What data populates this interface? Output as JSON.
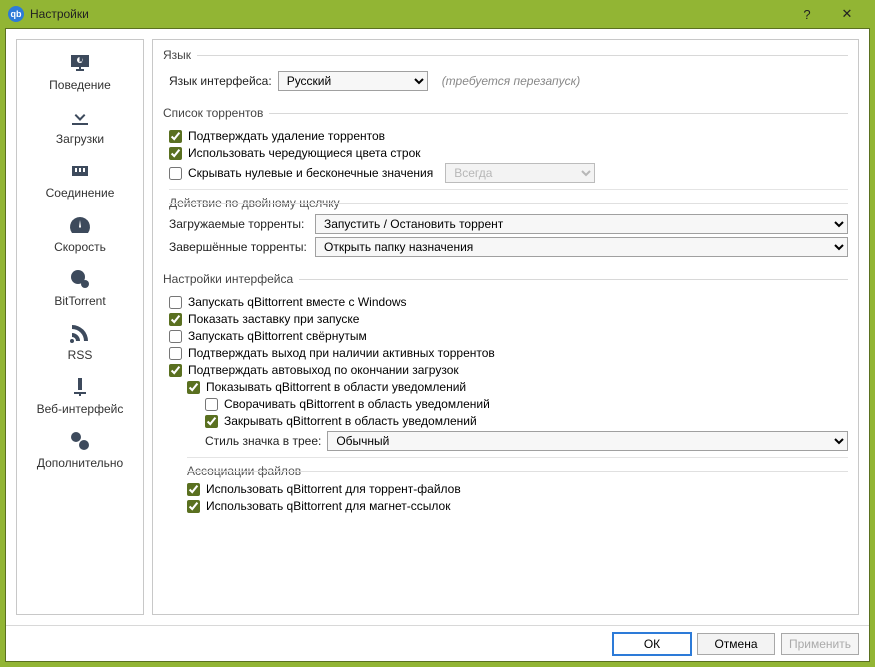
{
  "window": {
    "title": "Настройки",
    "app_icon_text": "qb"
  },
  "sidebar": {
    "items": [
      {
        "label": "Поведение"
      },
      {
        "label": "Загрузки"
      },
      {
        "label": "Соединение"
      },
      {
        "label": "Скорость"
      },
      {
        "label": "BitTorrent"
      },
      {
        "label": "RSS"
      },
      {
        "label": "Веб-интерфейс"
      },
      {
        "label": "Дополнительно"
      }
    ]
  },
  "lang": {
    "group": "Язык",
    "label": "Язык интерфейса:",
    "value": "Русский",
    "hint": "(требуется перезапуск)"
  },
  "torrents": {
    "group": "Список торрентов",
    "confirm_delete": "Подтверждать удаление торрентов",
    "alt_rows": "Использовать чередующиеся цвета строк",
    "hide_zero": "Скрывать нулевые и бесконечные значения",
    "hide_zero_mode": "Всегда",
    "dbl": {
      "group": "Действие по двойному щелчку",
      "downloading_label": "Загружаемые торренты:",
      "downloading_value": "Запустить / Остановить торрент",
      "completed_label": "Завершённые торренты:",
      "completed_value": "Открыть папку назначения"
    }
  },
  "ui": {
    "group": "Настройки интерфейса",
    "start_with_windows": "Запускать qBittorrent вместе с Windows",
    "show_splash": "Показать заставку при запуске",
    "start_minimized": "Запускать qBittorrent свёрнутым",
    "confirm_exit_active": "Подтверждать выход при наличии активных торрентов",
    "confirm_autoexit": "Подтверждать автовыход по окончании загрузок",
    "tray": {
      "show": "Показывать qBittorrent в области уведомлений",
      "minimize": "Сворачивать qBittorrent в область уведомлений",
      "close": "Закрывать qBittorrent в область уведомлений",
      "style_label": "Стиль значка в трее:",
      "style_value": "Обычный"
    },
    "assoc": {
      "group": "Ассоциации файлов",
      "torrent_files": "Использовать qBittorrent для торрент-файлов",
      "magnet_links": "Использовать qBittorrent для магнет-ссылок"
    }
  },
  "footer": {
    "ok": "ОК",
    "cancel": "Отмена",
    "apply": "Применить"
  }
}
